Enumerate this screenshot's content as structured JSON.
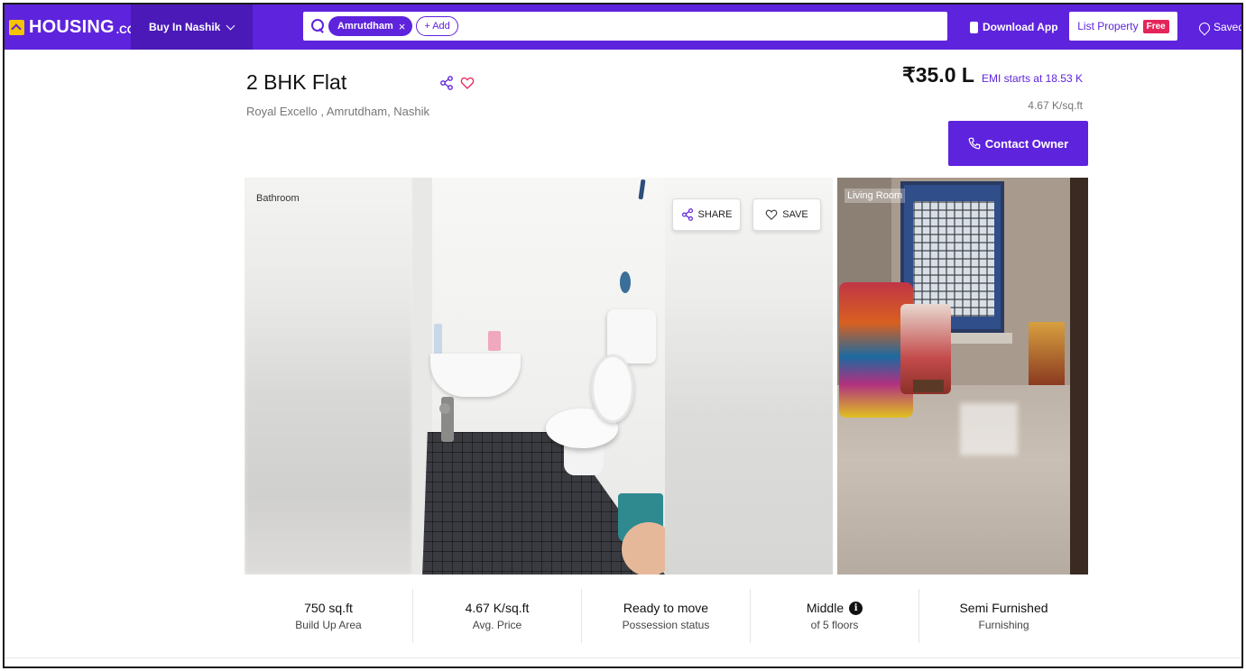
{
  "header": {
    "logo_text": "HOUSING",
    "logo_suffix": ".COM",
    "city_label": "Buy In Nashik",
    "search_chip": "Amrutdham",
    "search_chip_remove": "×",
    "add_label": "+ Add",
    "download_app": "Download App",
    "list_property": "List Property",
    "free_badge": "Free",
    "saved": "Saved"
  },
  "listing": {
    "title": "2 BHK Flat",
    "address": "Royal Excello , Amrutdham, Nashik",
    "price": "₹35.0 L",
    "emi": "EMI starts at  18.53 K",
    "price_per_sqft": "4.67 K/sq.ft",
    "contact_button": "Contact Owner"
  },
  "gallery": {
    "main_label": "Bathroom",
    "share_label": "SHARE",
    "save_label": "SAVE",
    "side_label": "Living Room"
  },
  "stats": [
    {
      "value": "750 sq.ft",
      "label": "Build Up Area"
    },
    {
      "value": "4.67 K/sq.ft",
      "label": "Avg. Price"
    },
    {
      "value": "Ready to move",
      "label": "Possession status"
    },
    {
      "value": "Middle",
      "label": "of 5 floors",
      "info_icon": "info-icon"
    },
    {
      "value": "Semi Furnished",
      "label": "Furnishing"
    }
  ],
  "colors": {
    "brand": "#5e23dc",
    "free_badge": "#e5245a",
    "logo_yellow": "#f4c400"
  }
}
